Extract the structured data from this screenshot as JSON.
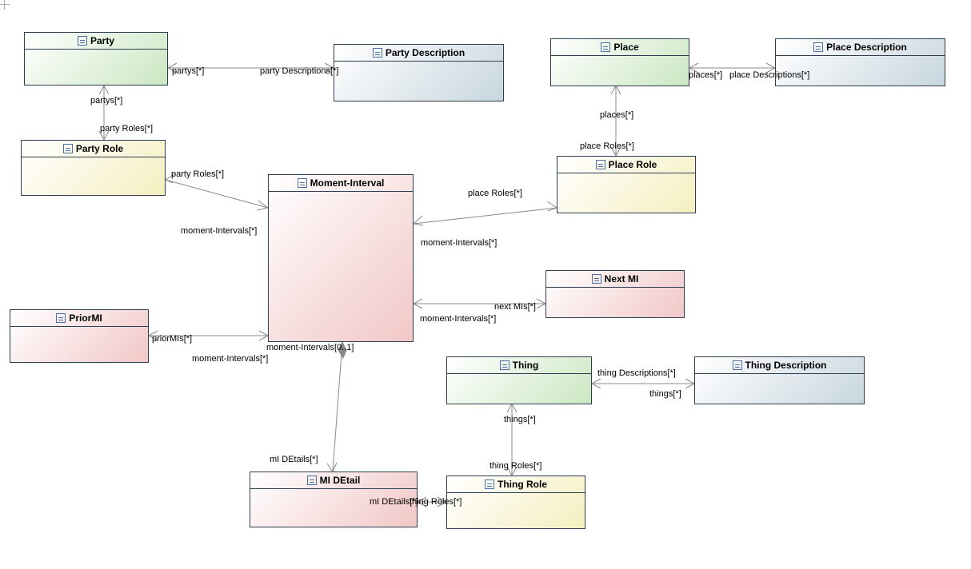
{
  "classes": {
    "party": {
      "label": "Party"
    },
    "partyDesc": {
      "label": "Party Description"
    },
    "partyRole": {
      "label": "Party Role"
    },
    "place": {
      "label": "Place"
    },
    "placeDesc": {
      "label": "Place Description"
    },
    "placeRole": {
      "label": "Place Role"
    },
    "momentInterval": {
      "label": "Moment-Interval"
    },
    "priorMI": {
      "label": "PriorMI"
    },
    "nextMI": {
      "label": "Next MI"
    },
    "thing": {
      "label": "Thing"
    },
    "thingDesc": {
      "label": "Thing Description"
    },
    "thingRole": {
      "label": "Thing Role"
    },
    "miDetail": {
      "label": "MI DEtail"
    }
  },
  "labels": {
    "partysTop": "partys[*]",
    "partyDescriptions": "party Descriptions[*]",
    "partysLeft": "partys[*]",
    "partyRoles1": "party Roles[*]",
    "partyRoles2": "party Roles[*]",
    "momentIntervals1": "moment-Intervals[*]",
    "places": "places[*]",
    "placeDescriptions": "place Descriptions[*]",
    "places2": "places[*]",
    "placeRoles1": "place Roles[*]",
    "placeRoles2": "place Roles[*]",
    "momentIntervals2": "moment-Intervals[*]",
    "nextMIs": "next MIs[*]",
    "momentIntervals3": "moment-Intervals[*]",
    "priorMIs": "priorMIs[*]",
    "momentIntervals4": "moment-Intervals[*]",
    "momentIntervals01": "moment-Intervals[0..1]",
    "miDetails": "mI DEtails[*]",
    "miDetailsThing": "mI DEtails[*]",
    "thingRolesOv": "thing Roles[*]",
    "things1": "things[*]",
    "thingRoles1": "thing Roles[*]",
    "thingDescriptions": "thing Descriptions[*]",
    "things2": "things[*]"
  }
}
